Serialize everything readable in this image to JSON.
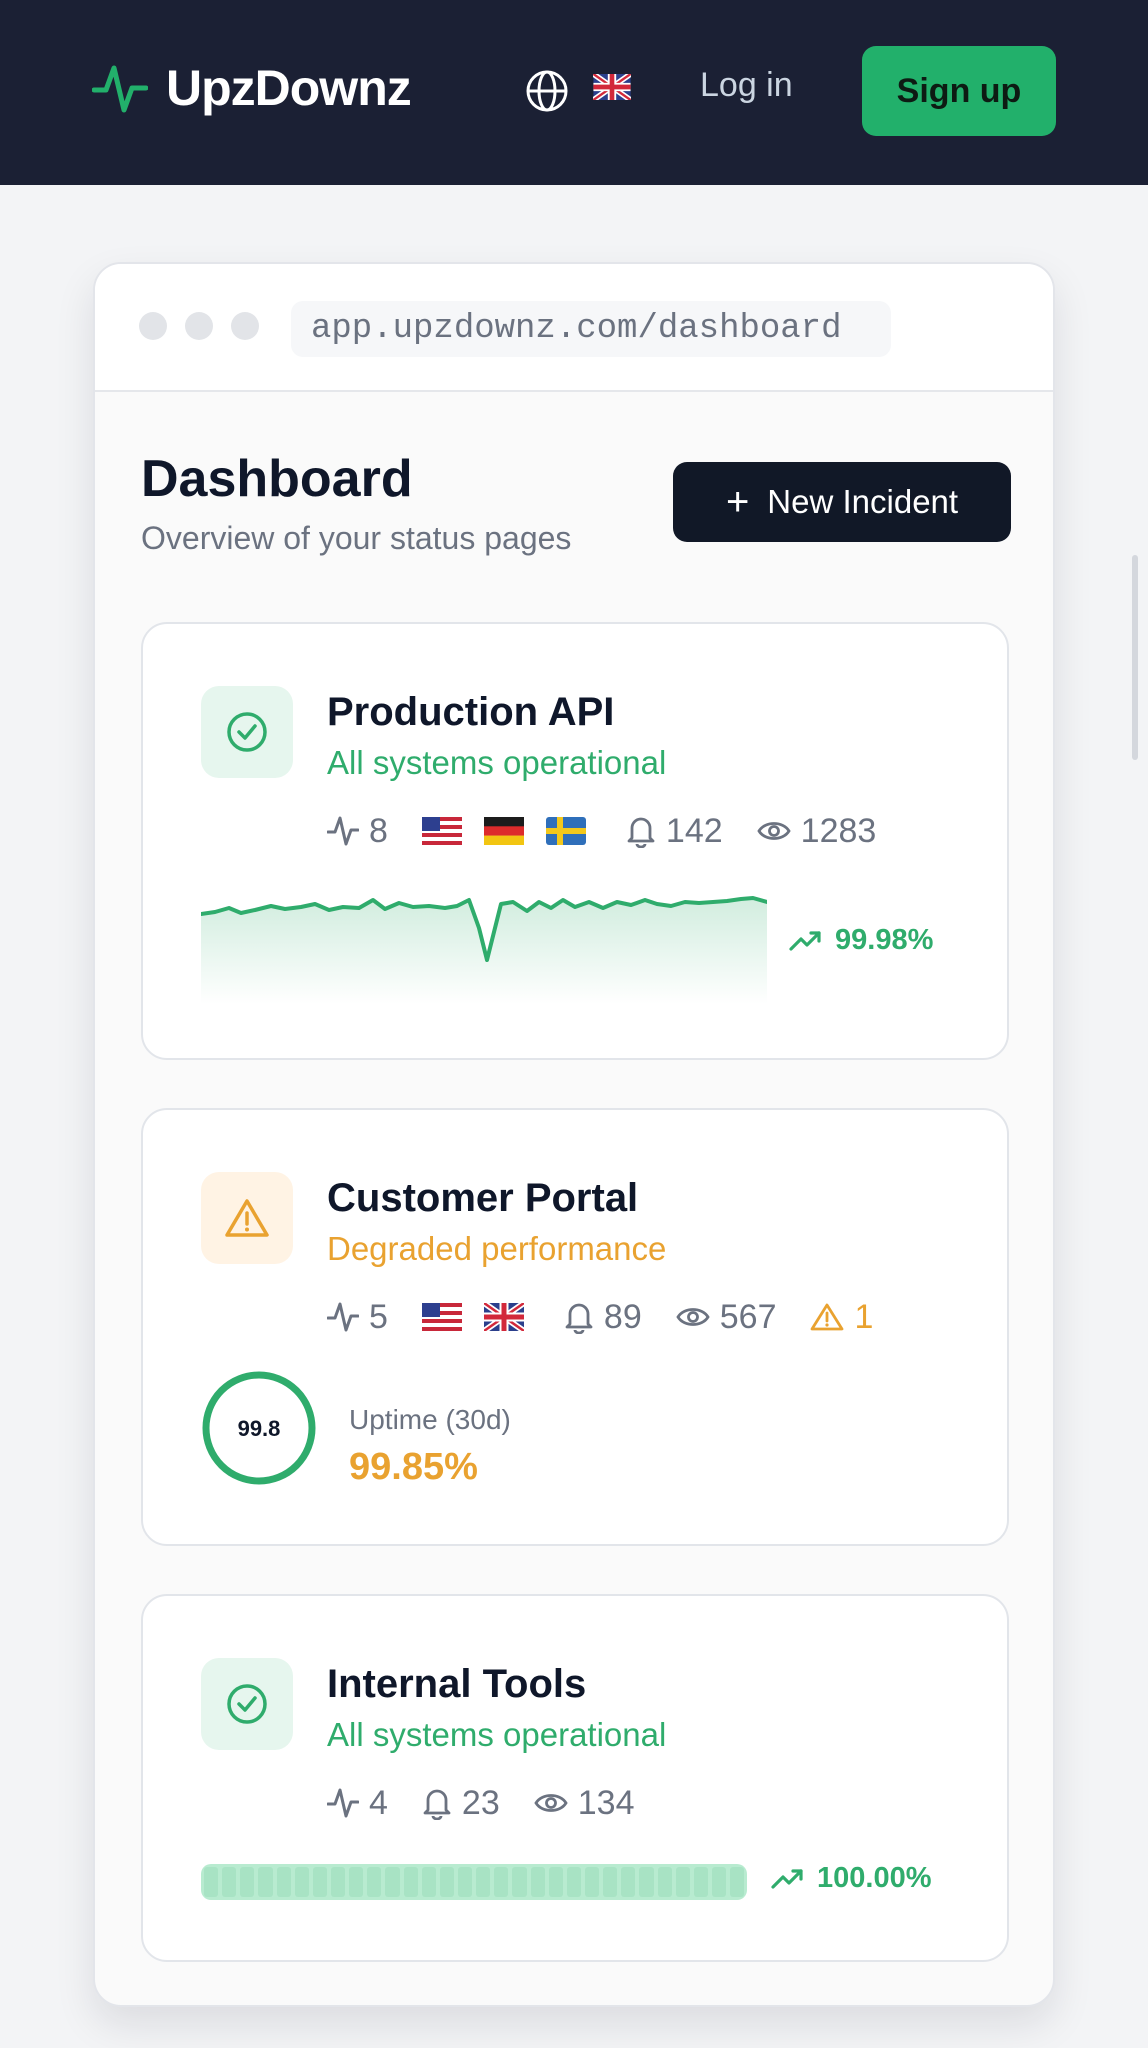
{
  "nav": {
    "brand": "UpzDownz",
    "login": "Log in",
    "signup": "Sign up"
  },
  "browser": {
    "url": "app.upzdownz.com/dashboard"
  },
  "dashboard": {
    "title": "Dashboard",
    "subtitle": "Overview of your status pages",
    "new_incident": "New Incident"
  },
  "cards": [
    {
      "title": "Production API",
      "status": "All systems operational",
      "status_level": "operational",
      "monitors": "8",
      "regions": [
        "us-flag",
        "de-flag",
        "se-flag"
      ],
      "subscribers": "142",
      "views": "1283",
      "uptime": "99.98%"
    },
    {
      "title": "Customer Portal",
      "status": "Degraded performance",
      "status_level": "degraded",
      "monitors": "5",
      "regions": [
        "us-flag",
        "gb-flag"
      ],
      "subscribers": "89",
      "views": "567",
      "incidents": "1",
      "ring_value": "99.8",
      "uptime_label": "Uptime (30d)",
      "uptime": "99.85%"
    },
    {
      "title": "Internal Tools",
      "status": "All systems operational",
      "status_level": "operational",
      "monitors": "4",
      "subscribers": "23",
      "views": "134",
      "uptime": "100.00%"
    }
  ],
  "colors": {
    "navbar": "#1b2034",
    "accent_green": "#22b06b",
    "operational": "#2fac6c",
    "degraded": "#e9a230",
    "dark_button": "#111827"
  }
}
